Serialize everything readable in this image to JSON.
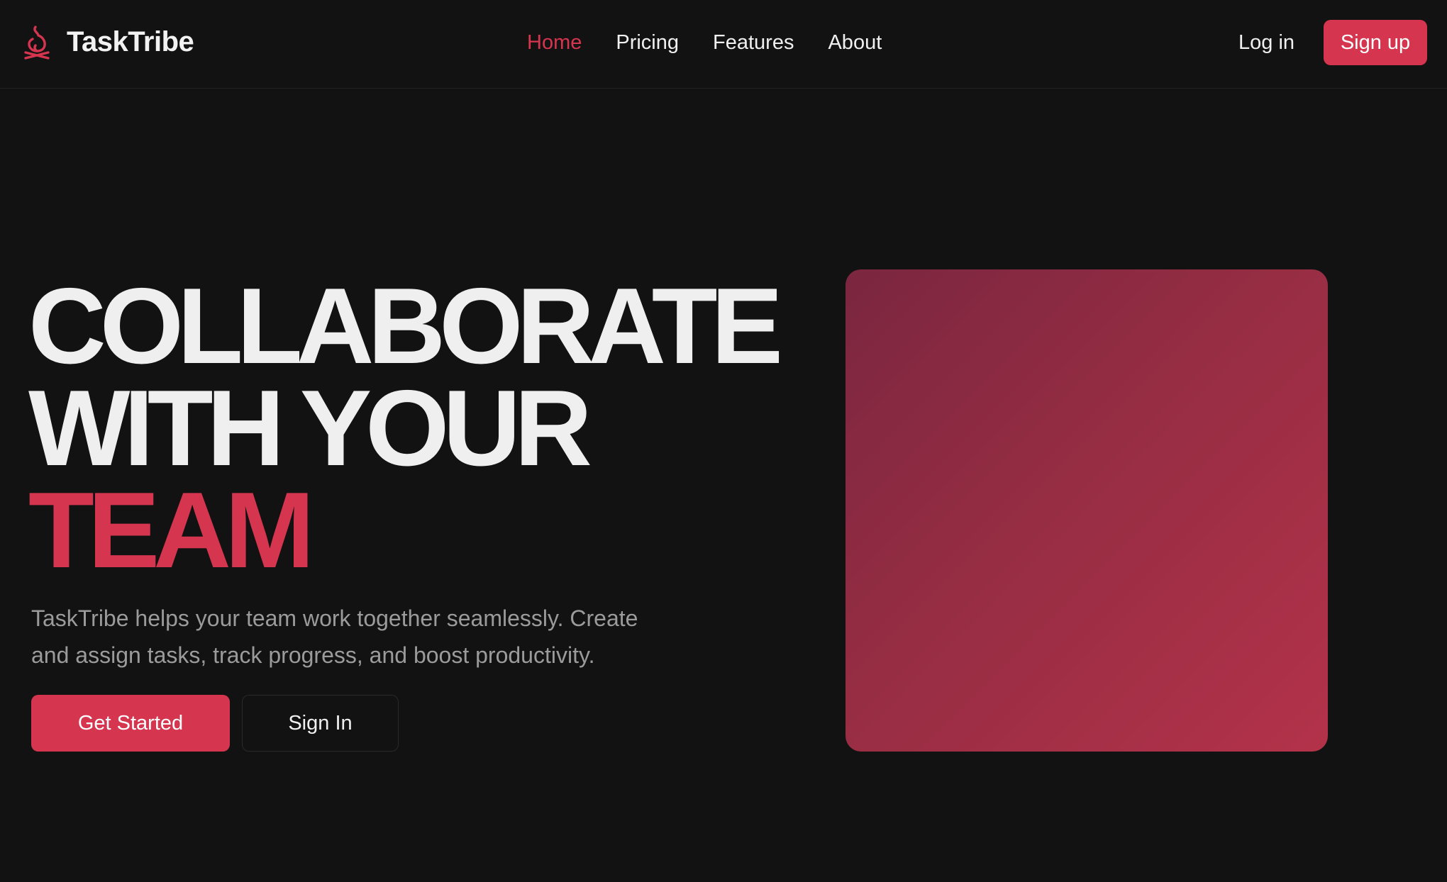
{
  "brand": {
    "name": "TaskTribe",
    "logo_icon": "flame-icon",
    "accent_color": "#d6354f"
  },
  "nav": {
    "links": [
      {
        "label": "Home",
        "active": true
      },
      {
        "label": "Pricing",
        "active": false
      },
      {
        "label": "Features",
        "active": false
      },
      {
        "label": "About",
        "active": false
      }
    ],
    "login_label": "Log in",
    "signup_label": "Sign up"
  },
  "hero": {
    "headline_line1": "COLLABORATE",
    "headline_line2": "WITH YOUR",
    "headline_accent": "TEAM",
    "subtext": "TaskTribe helps your team work together seamlessly. Create and assign tasks, track progress, and boost productivity.",
    "primary_cta": "Get Started",
    "secondary_cta": "Sign In"
  },
  "colors": {
    "background": "#121212",
    "text": "#f0f0f0",
    "muted_text": "#9b9b9b",
    "visual_gradient_start": "#7b2640",
    "visual_gradient_end": "#b3324a"
  }
}
